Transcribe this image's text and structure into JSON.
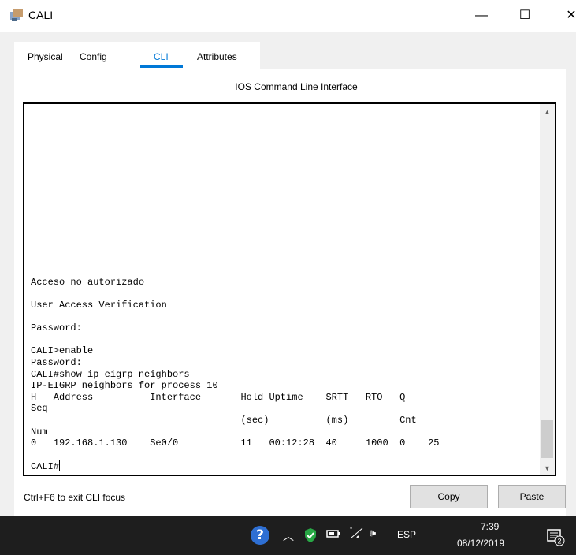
{
  "window": {
    "title": "CALI",
    "minimize": "—",
    "maximize": "☐",
    "close": "✕"
  },
  "tabs": [
    {
      "label": "Physical"
    },
    {
      "label": "Config"
    },
    {
      "label": "CLI"
    },
    {
      "label": "Attributes"
    }
  ],
  "active_tab": "CLI",
  "panel": {
    "header": "IOS Command Line Interface"
  },
  "terminal": {
    "lines": [
      "Acceso no autorizado",
      "",
      "User Access Verification",
      "",
      "Password:",
      "",
      "CALI>enable",
      "Password:",
      "CALI#show ip eigrp neighbors",
      "IP-EIGRP neighbors for process 10",
      "H   Address          Interface       Hold Uptime    SRTT   RTO   Q",
      "Seq",
      "                                     (sec)          (ms)         Cnt",
      "Num",
      "0   192.168.1.130    Se0/0           11   00:12:28  40     1000  0    25",
      "",
      "CALI#"
    ]
  },
  "footer": {
    "focus_hint": "Ctrl+F6 to exit CLI focus",
    "copy": "Copy",
    "paste": "Paste"
  },
  "taskbar": {
    "language": "ESP",
    "time": "7:39",
    "date": "08/12/2019",
    "notifications": "2"
  },
  "colors": {
    "accent": "#0078d7",
    "taskbar": "#1e1e1e",
    "shield": "#28a745"
  }
}
